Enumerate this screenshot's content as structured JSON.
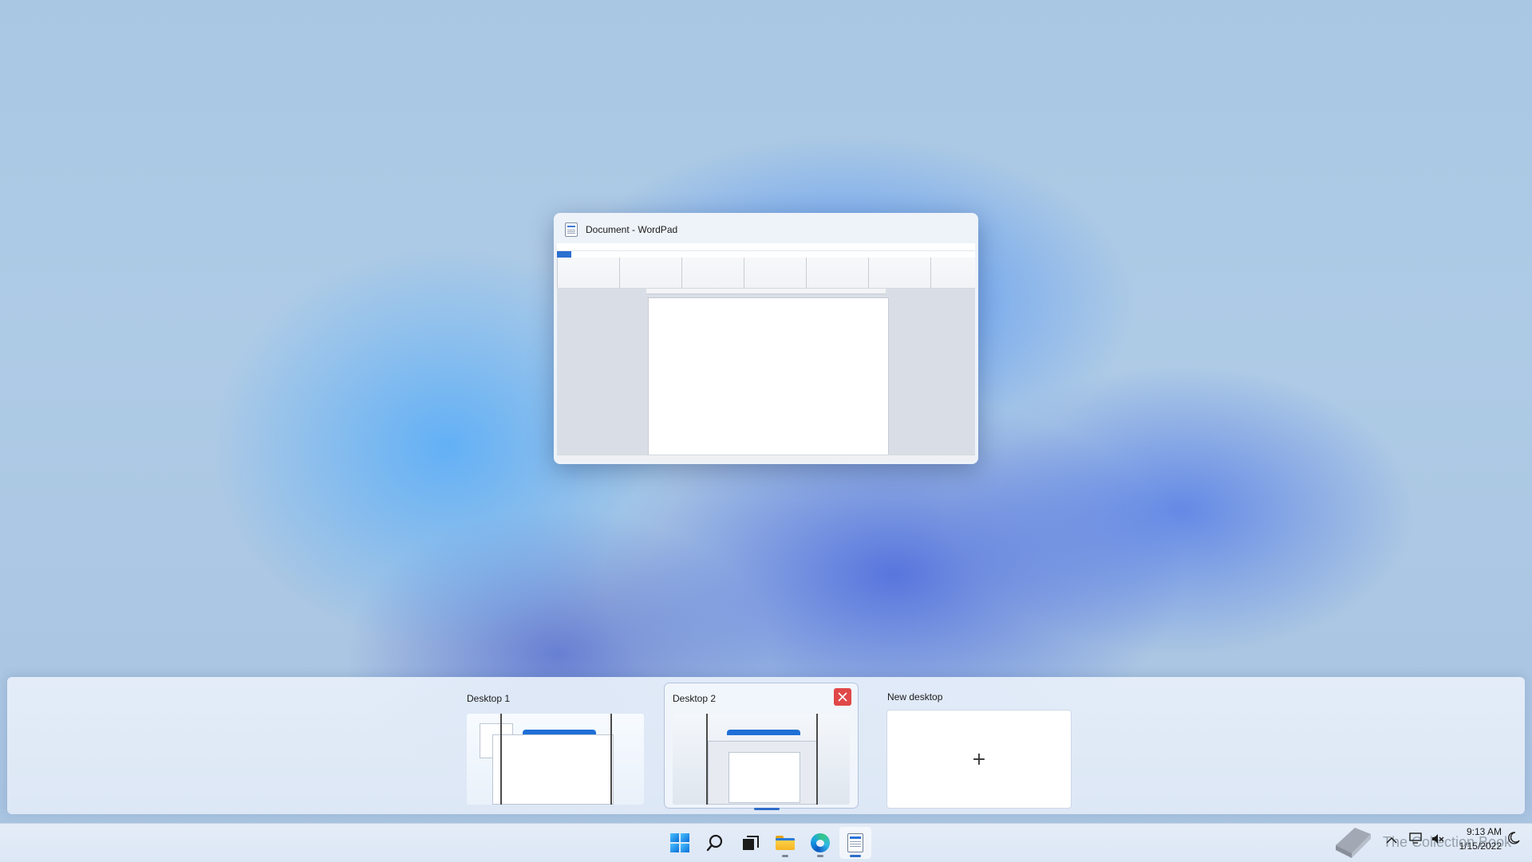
{
  "task_view": {
    "windows": [
      {
        "title": "Document - WordPad",
        "app_icon": "wordpad-icon"
      }
    ]
  },
  "desktops": {
    "items": [
      {
        "label": "Desktop 1",
        "active": false
      },
      {
        "label": "Desktop 2",
        "active": true,
        "close_icon": "close-icon"
      }
    ],
    "new_desktop": {
      "label": "New desktop",
      "plus": "+"
    }
  },
  "taskbar": {
    "icons": [
      "start-icon",
      "search-icon",
      "task-view-icon",
      "file-explorer-icon",
      "edge-icon",
      "wordpad-icon"
    ],
    "tray": {
      "time": "9:13 AM",
      "date": "1/15/2022"
    },
    "watermark": "The Collection Book"
  },
  "colors": {
    "accent": "#2f6dc9",
    "close_red": "#e04848"
  }
}
